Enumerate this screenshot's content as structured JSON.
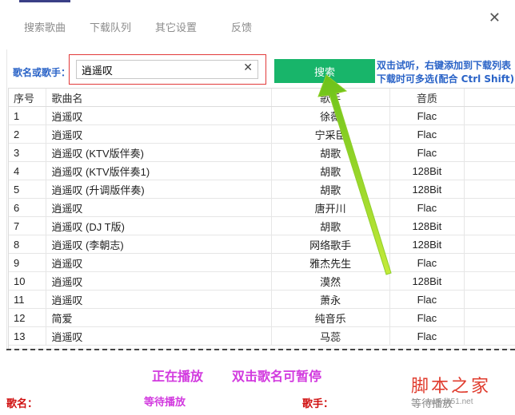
{
  "tabs": [
    "搜索歌曲",
    "下载队列",
    "其它设置",
    "反馈"
  ],
  "search": {
    "label": "歌名或歌手：",
    "value": "逍遥叹",
    "button": "搜索",
    "hint_line1": "双击试听，右键添加到下载列表",
    "hint_line2": "下载时可多选(配合 Ctrl Shift)"
  },
  "table": {
    "headers": [
      "序号",
      "歌曲名",
      "歌手",
      "音质"
    ],
    "rows": [
      {
        "no": "1",
        "name": "逍遥叹",
        "artist": "徐薇",
        "quality": "Flac"
      },
      {
        "no": "2",
        "name": "逍遥叹",
        "artist": "宁采臣",
        "quality": "Flac"
      },
      {
        "no": "3",
        "name": "逍遥叹 (KTV版伴奏)",
        "artist": "胡歌",
        "quality": "Flac"
      },
      {
        "no": "4",
        "name": "逍遥叹 (KTV版伴奏1)",
        "artist": "胡歌",
        "quality": "128Bit"
      },
      {
        "no": "5",
        "name": "逍遥叹 (升调版伴奏)",
        "artist": "胡歌",
        "quality": "128Bit"
      },
      {
        "no": "6",
        "name": "逍遥叹",
        "artist": "唐开川",
        "quality": "Flac"
      },
      {
        "no": "7",
        "name": "逍遥叹 (DJ T版)",
        "artist": "胡歌",
        "quality": "128Bit"
      },
      {
        "no": "8",
        "name": "逍遥叹 (李朝志)",
        "artist": "网络歌手",
        "quality": "128Bit"
      },
      {
        "no": "9",
        "name": "逍遥叹",
        "artist": "雅杰先生",
        "quality": "Flac"
      },
      {
        "no": "10",
        "name": "逍遥叹",
        "artist": "漠然",
        "quality": "128Bit"
      },
      {
        "no": "11",
        "name": "逍遥叹",
        "artist": "萧永",
        "quality": "Flac"
      },
      {
        "no": "12",
        "name": "简爱",
        "artist": "纯音乐",
        "quality": "Flac"
      },
      {
        "no": "13",
        "name": "逍遥叹",
        "artist": "马蕊",
        "quality": "Flac"
      }
    ]
  },
  "player": {
    "status": "正在播放",
    "hint": "双击歌名可暂停",
    "song_label": "歌名：",
    "song_value": "等待播放",
    "artist_label": "歌手：",
    "artist_value": "等待播放"
  },
  "watermark": {
    "text": "脚本之家",
    "url": "www.jb51.net"
  },
  "icons": {
    "close": "close-icon",
    "clear": "clear-icon"
  }
}
